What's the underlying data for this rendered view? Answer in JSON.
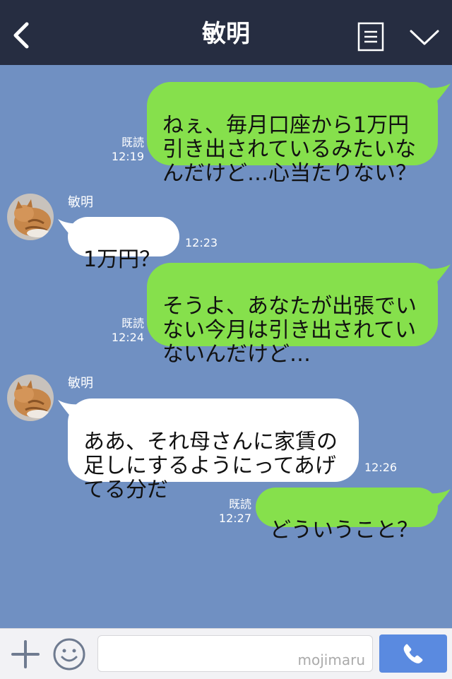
{
  "header": {
    "title": "敏明"
  },
  "messages": [
    {
      "dir": "out",
      "text": "ねぇ、毎月口座から1万円\n引き出されているみたいな\nんだけど…心当たりない？",
      "read": "既読",
      "time": "12:19"
    },
    {
      "dir": "in",
      "sender": "敏明",
      "text": "1万円？",
      "time": "12:23"
    },
    {
      "dir": "out",
      "text": "そうよ、あなたが出張でい\nない今月は引き出されてい\nないんだけど…",
      "read": "既読",
      "time": "12:24"
    },
    {
      "dir": "in",
      "sender": "敏明",
      "text": "ああ、それ母さんに家賃の\n足しにするようにってあげ\nてる分だ",
      "time": "12:26"
    },
    {
      "dir": "out",
      "text": "どういうこと？",
      "read": "既読",
      "time": "12:27"
    }
  ],
  "input": {
    "watermark": "mojimaru"
  },
  "colors": {
    "header_bg": "#262d41",
    "chat_bg": "#7090c2",
    "outgoing_bubble": "#86e04c",
    "incoming_bubble": "#ffffff",
    "call_button": "#5a8ae0"
  },
  "icons": [
    "back-arrow-icon",
    "menu-icon",
    "chevron-down-icon",
    "plus-icon",
    "smiley-icon",
    "phone-icon"
  ]
}
